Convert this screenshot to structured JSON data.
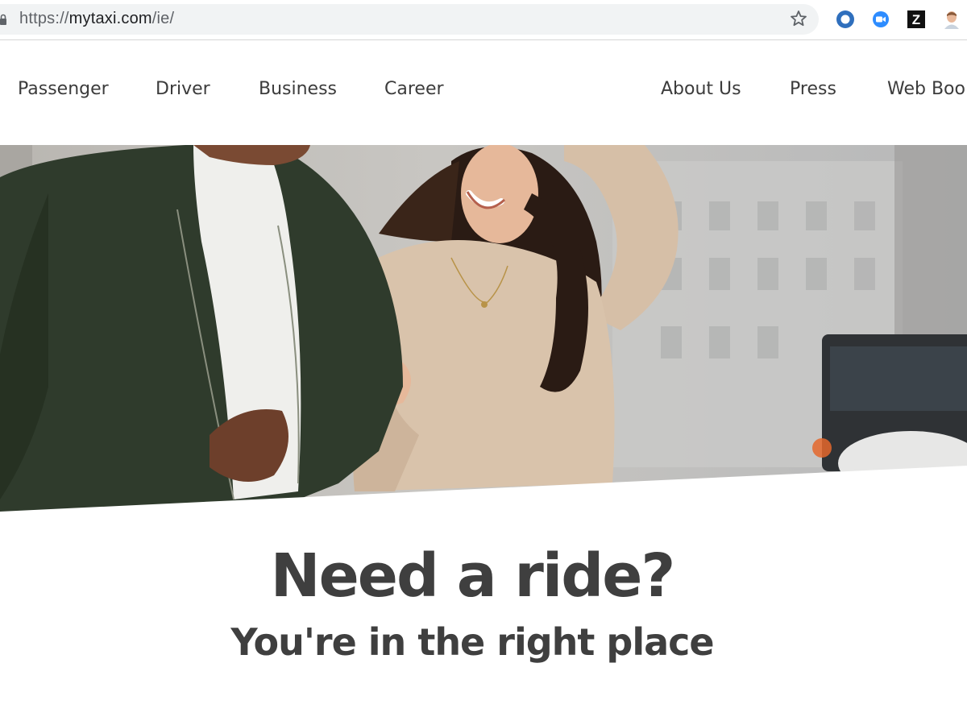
{
  "browser": {
    "url_scheme": "https://",
    "url_host": "mytaxi.com",
    "url_path": "/ie/",
    "extensions": [
      {
        "icon": "ring-extension-icon",
        "color": "#2f6fbd"
      },
      {
        "icon": "video-camera-extension-icon",
        "color": "#2d8cff"
      },
      {
        "icon": "z-extension-icon",
        "color": "#111111",
        "label": "Z"
      },
      {
        "icon": "avatar-extension-icon"
      }
    ]
  },
  "nav": {
    "left": [
      {
        "label": "Passenger"
      },
      {
        "label": "Driver"
      },
      {
        "label": "Business"
      },
      {
        "label": "Career"
      }
    ],
    "right": [
      {
        "label": "About Us"
      },
      {
        "label": "Press"
      },
      {
        "label": "Web Book"
      }
    ]
  },
  "hero": {
    "image": "couple-walking-street-photo"
  },
  "content": {
    "headline": "Need a ride?",
    "subheadline": "You're in the right place"
  },
  "colors": {
    "text_dark": "#3f3f3f",
    "nav_text": "#3c3c3c",
    "omnibox_bg": "#f1f3f4"
  }
}
